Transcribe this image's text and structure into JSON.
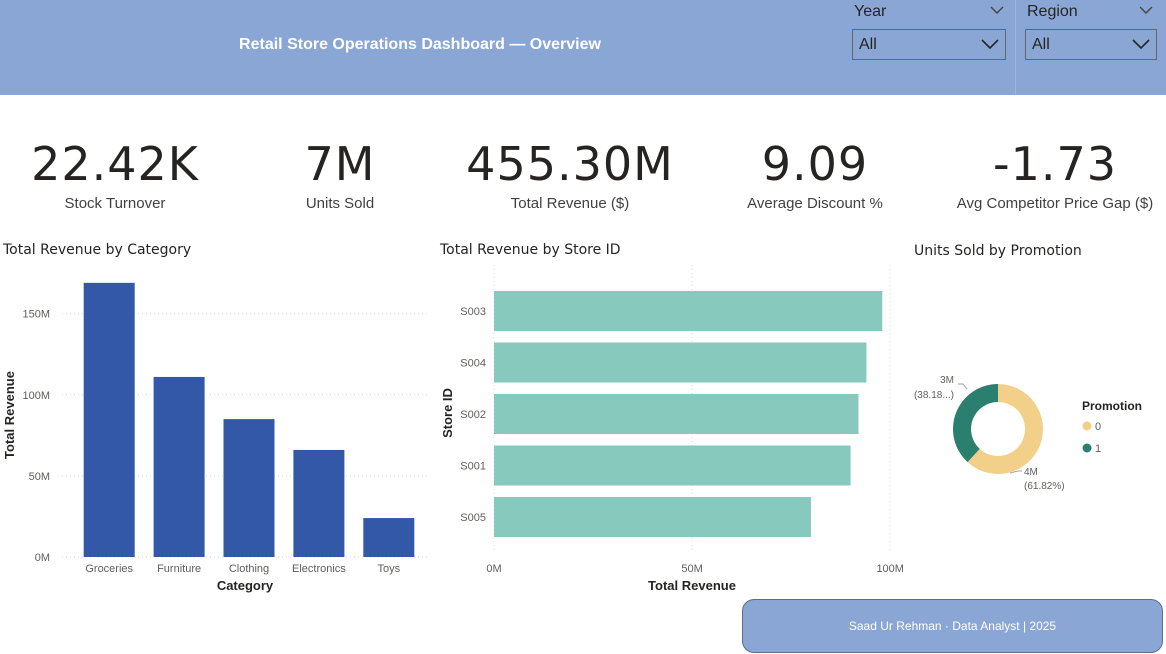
{
  "header": {
    "title": "Retail Store Operations Dashboard — Overview"
  },
  "slicers": [
    {
      "label": "Year",
      "value": "All"
    },
    {
      "label": "Region",
      "value": "All"
    }
  ],
  "kpis": [
    {
      "value": "22.42K",
      "label": "Stock Turnover"
    },
    {
      "value": "7M",
      "label": "Units Sold"
    },
    {
      "value": "455.30M",
      "label": "Total Revenue ($)"
    },
    {
      "value": "9.09",
      "label": "Average Discount %"
    },
    {
      "value": "-1.73",
      "label": "Avg Competitor Price Gap ($)"
    }
  ],
  "colors": {
    "header": "#8aa6d4",
    "category_bar": "#3358a8",
    "store_bar": "#87cabd",
    "promo_0": "#f3d08a",
    "promo_1": "#2a7f6f"
  },
  "chart_data": [
    {
      "type": "bar",
      "title": "Total Revenue by Category",
      "xlabel": "Category",
      "ylabel": "Total Revenue",
      "categories": [
        "Groceries",
        "Furniture",
        "Clothing",
        "Electronics",
        "Toys"
      ],
      "values": [
        169,
        111,
        85,
        66,
        24
      ],
      "value_unit": "M",
      "ylim": [
        0,
        180
      ],
      "yticks": [
        "0M",
        "50M",
        "100M",
        "150M"
      ],
      "grid": true
    },
    {
      "type": "bar",
      "orientation": "horizontal",
      "title": "Total Revenue by Store ID",
      "xlabel": "Total Revenue",
      "ylabel": "Store ID",
      "categories": [
        "S003",
        "S004",
        "S002",
        "S001",
        "S005"
      ],
      "values": [
        98,
        94,
        92,
        90,
        80
      ],
      "value_unit": "M",
      "xlim": [
        0,
        100
      ],
      "xticks": [
        "0M",
        "50M",
        "100M"
      ],
      "grid": true
    },
    {
      "type": "pie",
      "donut": true,
      "title": "Units Sold by Promotion",
      "legend_title": "Promotion",
      "legend_position": "right",
      "slices": [
        {
          "name": "0",
          "value": 61.82,
          "label_value": "4M",
          "label_pct": "(61.82%)"
        },
        {
          "name": "1",
          "value": 38.18,
          "label_value": "3M",
          "label_pct": "(38.18...)"
        }
      ]
    }
  ],
  "footer": {
    "text": "Saad Ur Rehman · Data Analyst | 2025"
  }
}
